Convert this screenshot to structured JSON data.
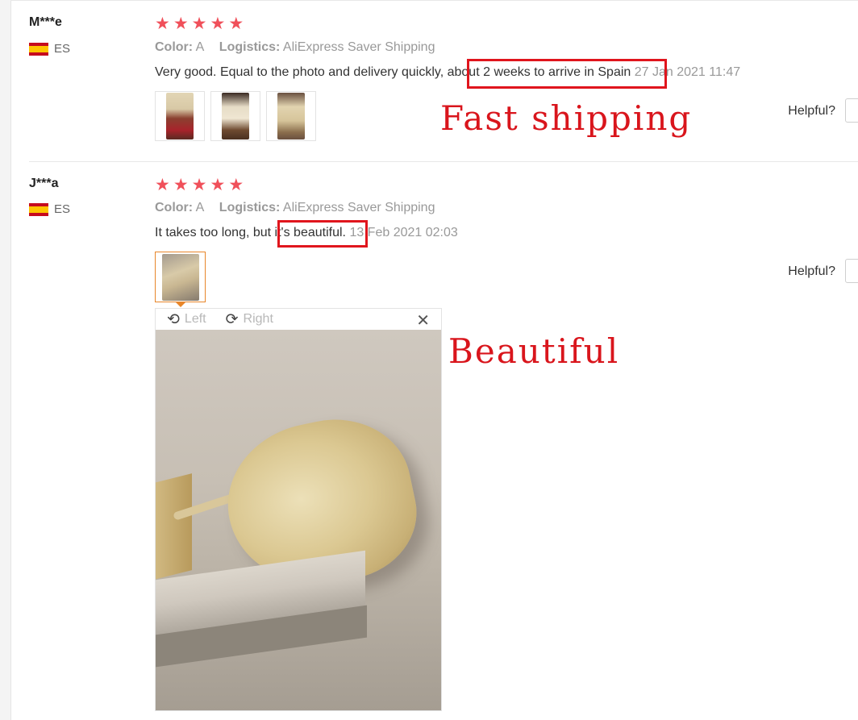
{
  "reviews": [
    {
      "user": "M***e",
      "country": "ES",
      "stars": 5,
      "color_label": "Color:",
      "color_value": "A",
      "logistics_label": "Logistics:",
      "logistics_value": "AliExpress Saver Shipping",
      "text_before": "Very good. Equal to the photo and delivery quickly, ",
      "text_highlight": "about 2 weeks to arrive in Spain",
      "date": "27 Jan 2021 11:47",
      "helpful_label": "Helpful?",
      "annotation": "Fast shipping"
    },
    {
      "user": "J***a",
      "country": "ES",
      "stars": 5,
      "color_label": "Color:",
      "color_value": "A",
      "logistics_label": "Logistics:",
      "logistics_value": "AliExpress Saver Shipping",
      "text_before": "It takes too long, but ",
      "text_highlight": "it's beautiful.",
      "date": "13 Feb 2021 02:03",
      "helpful_label": "Helpful?",
      "annotation": "Beautiful"
    }
  ],
  "viewer": {
    "rotate_left_label": "Left",
    "rotate_right_label": "Right",
    "close_icon": "close-icon"
  },
  "colors": {
    "star": "#f0505a",
    "highlight_box": "#e0151d",
    "annotation_text": "#d9151c",
    "active_thumb_border": "#e8862a"
  }
}
